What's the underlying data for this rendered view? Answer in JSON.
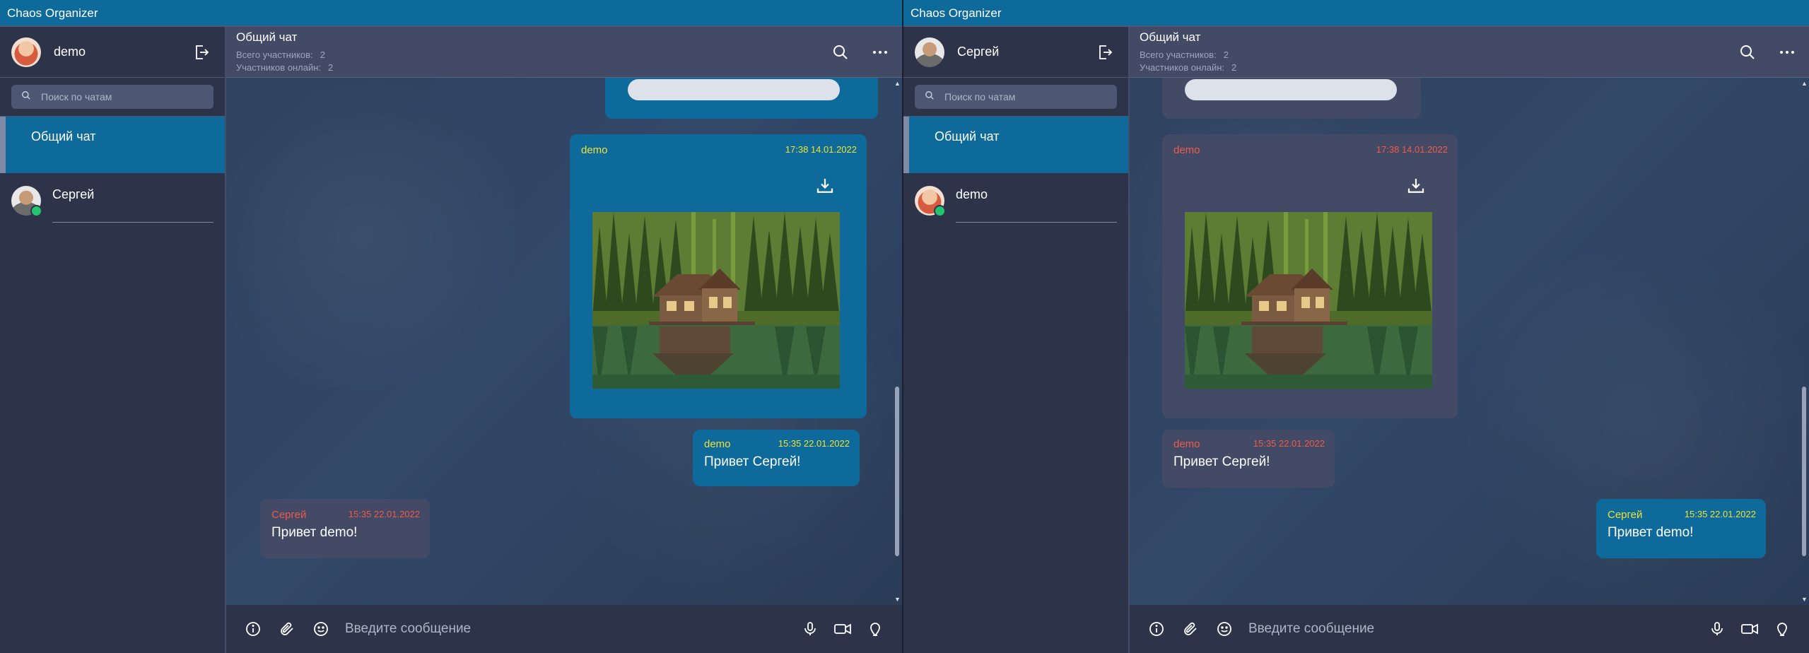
{
  "app_title": "Chaos Organizer",
  "search_placeholder": "Поиск по чатам",
  "composer_placeholder": "Введите сообщение",
  "colors": {
    "titlebar": "#0e6a9b",
    "my_bubble": "#0e6a9b",
    "other_bubble": "#424a66",
    "my_author": "#f0e234",
    "other_author": "#ef5a4a",
    "online": "#23c36f"
  },
  "chat_header": {
    "title": "Общий чат",
    "total_label": "Всего участников:",
    "total_value": "2",
    "online_label": "Участников онлайн:",
    "online_value": "2"
  },
  "left_window": {
    "user_name": "demo",
    "chats": [
      {
        "name": "Общий чат"
      },
      {
        "name": "Сергей"
      }
    ],
    "messages": [
      {
        "author": "demo",
        "time": "17:38 14.01.2022",
        "attachment": "image"
      },
      {
        "author": "demo",
        "time": "15:35 22.01.2022",
        "text": "Привет Сергей!"
      },
      {
        "author": "Сергей",
        "time": "15:35 22.01.2022",
        "text": "Привет demo!"
      }
    ]
  },
  "right_window": {
    "user_name": "Сергей",
    "chats": [
      {
        "name": "Общий чат"
      },
      {
        "name": "demo"
      }
    ],
    "messages": [
      {
        "author": "demo",
        "time": "17:38 14.01.2022",
        "attachment": "image"
      },
      {
        "author": "demo",
        "time": "15:35 22.01.2022",
        "text": "Привет Сергей!"
      },
      {
        "author": "Сергей",
        "time": "15:35 22.01.2022",
        "text": "Привет demo!"
      }
    ]
  }
}
